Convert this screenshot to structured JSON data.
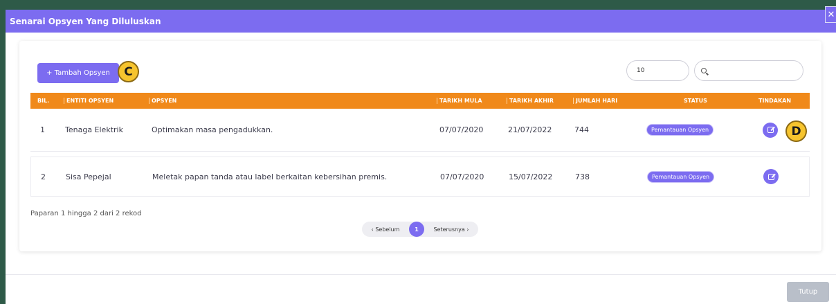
{
  "modal": {
    "title": "Senarai Opsyen Yang Diluluskan",
    "close_icon": "close-icon",
    "accent_color": "#7c6cf0",
    "header_color": "#f0891a"
  },
  "toolbar": {
    "add_label": "+ Tambah Opsyen",
    "page_length": "10",
    "search_icon": "search-icon"
  },
  "callouts": {
    "c": "C",
    "d": "D"
  },
  "table": {
    "headers": [
      "BIL.",
      "ENTITI OPSYEN",
      "OPSYEN",
      "TARIKH MULA",
      "TARIKH AKHIR",
      "JUMLAH HARI",
      "STATUS",
      "TINDAKAN"
    ],
    "rows": [
      {
        "bil": "1",
        "entiti": "Tenaga Elektrik",
        "opsyen": "Optimakan masa pengadukkan.",
        "mula": "07/07/2020",
        "akhir": "21/07/2022",
        "hari": "744",
        "status": "Pemantauan Opsyen"
      },
      {
        "bil": "2",
        "entiti": "Sisa Pepejal",
        "opsyen": "Meletak papan tanda atau label berkaitan kebersihan premis.",
        "mula": "07/07/2020",
        "akhir": "15/07/2022",
        "hari": "738",
        "status": "Pemantauan Opsyen"
      }
    ]
  },
  "info": "Paparan 1 hingga 2 dari 2 rekod",
  "pagination": {
    "prev": "‹ Sebelum",
    "current": "1",
    "next": "Seterusnya ›"
  },
  "footer": {
    "close_label": "Tutup"
  }
}
